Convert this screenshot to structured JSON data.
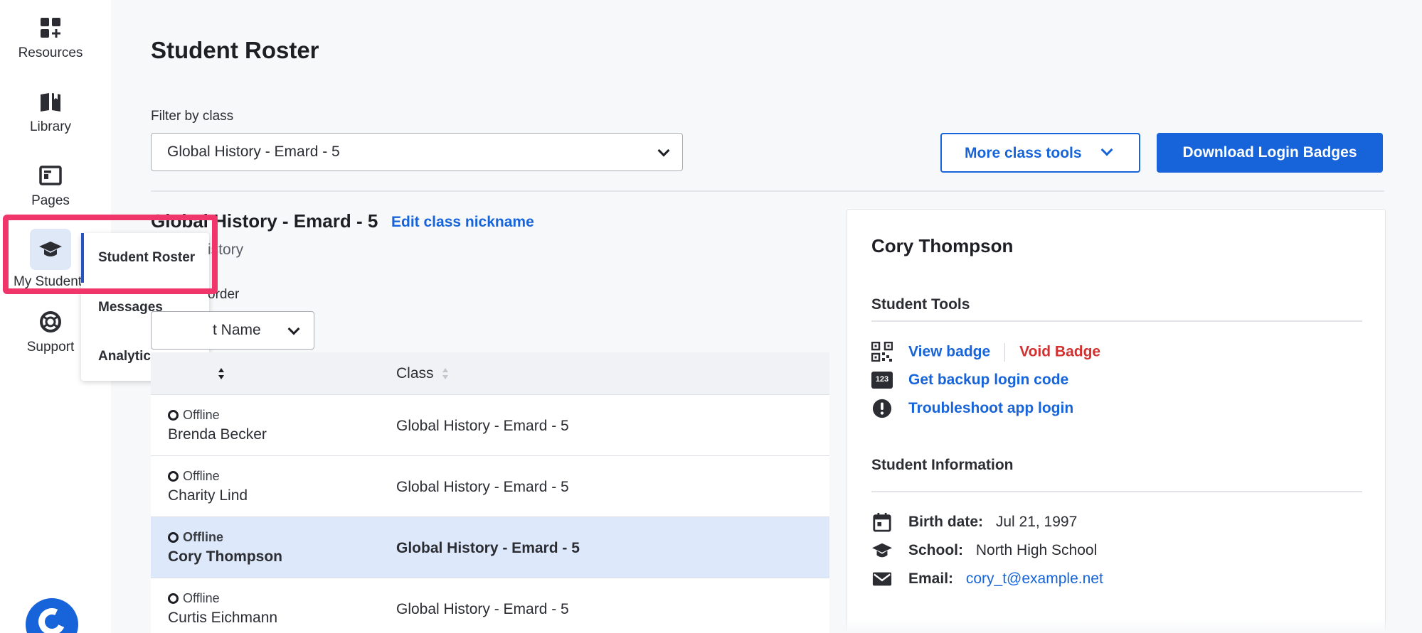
{
  "rail": {
    "items": [
      {
        "label": "Resources",
        "icon": "grid-plus-icon"
      },
      {
        "label": "Library",
        "icon": "book-icon"
      },
      {
        "label": "Pages",
        "icon": "page-icon"
      },
      {
        "label": "My Student",
        "icon": "graduation-cap-icon"
      },
      {
        "label": "Support",
        "icon": "lifebuoy-icon"
      }
    ]
  },
  "flyout": {
    "items": [
      {
        "label": "Student Roster"
      },
      {
        "label": "Messages"
      },
      {
        "label": "Analytics"
      }
    ]
  },
  "header": {
    "title": "Student Roster",
    "filter_label": "Filter by class",
    "filter_value": "Global History - Emard - 5",
    "more_tools": "More class tools",
    "download_badges": "Download Login Badges"
  },
  "class_info": {
    "title": "Global History - Emard - 5",
    "edit_nickname": "Edit class nickname",
    "subtitle": "istory",
    "sort_label": "order",
    "sort_value": "t Name"
  },
  "table": {
    "columns": [
      "Class"
    ],
    "rows": [
      {
        "status": "Offline",
        "name": "Brenda Becker",
        "class": "Global History - Emard - 5",
        "selected": false
      },
      {
        "status": "Offline",
        "name": "Charity Lind",
        "class": "Global History - Emard - 5",
        "selected": false
      },
      {
        "status": "Offline",
        "name": "Cory Thompson",
        "class": "Global History - Emard - 5",
        "selected": true
      },
      {
        "status": "Offline",
        "name": "Curtis Eichmann",
        "class": "Global History - Emard - 5",
        "selected": false
      }
    ]
  },
  "panel": {
    "student_name": "Cory Thompson",
    "tools_heading": "Student Tools",
    "view_badge": "View badge",
    "void_badge": "Void Badge",
    "backup_code": "Get backup login code",
    "troubleshoot": "Troubleshoot app login",
    "info_heading": "Student Information",
    "birth_label": "Birth date:",
    "birth_value": "Jul 21, 1997",
    "school_label": "School:",
    "school_value": "North High School",
    "email_label": "Email:",
    "email_value": "cory_t@example.net",
    "backup_badge": "123"
  },
  "colors": {
    "accent": "#1763d9",
    "highlight": "#f0356b",
    "danger": "#d3302f",
    "selected_row": "#dde9fb"
  }
}
